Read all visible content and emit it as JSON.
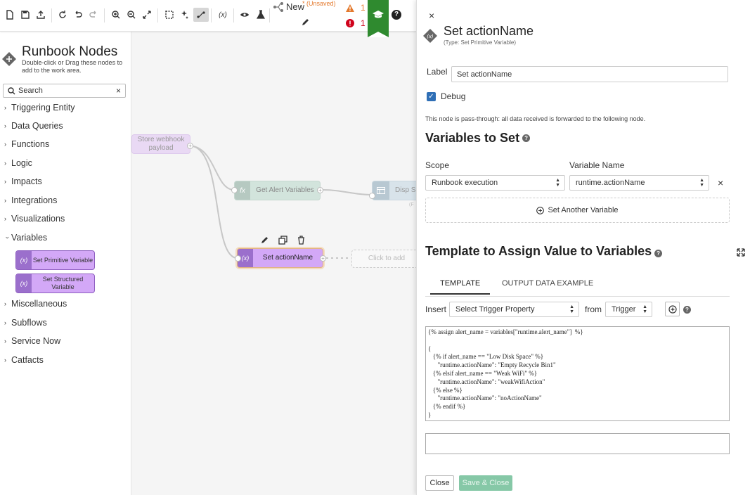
{
  "toolbar": {
    "flow_name": "New",
    "unsaved_label": "* (Unsaved)",
    "warning_count": "1",
    "error_count": "1",
    "help_label": "?"
  },
  "sidebar": {
    "title": "Runbook Nodes",
    "subtitle": "Double-click or Drag these nodes to add to the work area.",
    "search_placeholder": "Search",
    "search_clear": "×",
    "categories": [
      "Triggering Entity",
      "Data Queries",
      "Functions",
      "Logic",
      "Impacts",
      "Integrations",
      "Visualizations",
      "Variables",
      "Miscellaneous",
      "Subflows",
      "Service Now",
      "Catfacts"
    ],
    "variable_nodes": [
      {
        "icon": "(x)",
        "label": "Set Primitive Variable"
      },
      {
        "icon": "(x)",
        "label": "Set Structured Variable"
      }
    ]
  },
  "canvas": {
    "nodes": {
      "webhook": "Store webhook payload",
      "alert_vars": "Get Alert Variables",
      "alert_vars_icon": "fx",
      "display": "Disp Su",
      "display_sub": "(F",
      "set_action": "Set actionName",
      "set_action_icon": "(x)",
      "click_to_add": "Click to add"
    }
  },
  "panel": {
    "close": "×",
    "title": "Set actionName",
    "type_text": "(Type: Set Primitive Variable)",
    "label_caption": "Label",
    "label_value": "Set actionName",
    "debug_label": "Debug",
    "debug_checked": "✓",
    "pass_through": "This node is pass-through: all data received is forwarded to the following node.",
    "variables_heading": "Variables to Set",
    "scope_label": "Scope",
    "scope_value": "Runbook execution",
    "varname_label": "Variable Name",
    "varname_value": "runtime.actionName",
    "remove": "×",
    "add_another": "Set Another Variable",
    "template_heading": "Template to Assign Value to Variables",
    "tabs": [
      "TEMPLATE",
      "OUTPUT DATA EXAMPLE"
    ],
    "insert_label": "Insert",
    "insert_value": "Select Trigger Property",
    "from_label": "from",
    "from_value": "Trigger",
    "template_code": "{% assign alert_name = variables[\"runtime.alert_name\"]  %}\n\n{\n   {% if alert_name == \"Low Disk Space\" %}\n      \"runtime.actionName\": \"Empty Recycle Bin1\"\n   {% elsif alert_name == \"Weak WiFi\" %}\n      \"runtime.actionName\": \"weakWifiAction\"\n   {% else %}\n      \"runtime.actionName\": \"noActionName\"\n   {% endif %}\n}",
    "close_button": "Close",
    "save_button": "Save & Close"
  },
  "colors": {
    "accent_green": "#2f8a2f",
    "node_purple": "#d3a8f7",
    "checkbox_blue": "#2f6fb6",
    "save_green": "#86c8a7"
  }
}
